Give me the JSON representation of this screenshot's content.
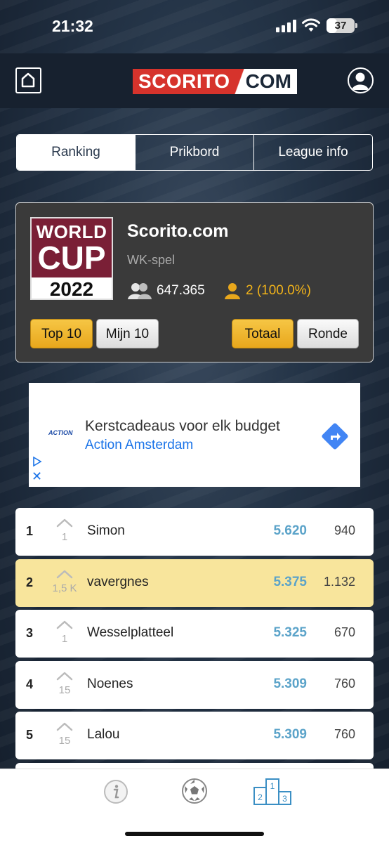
{
  "status_bar": {
    "time": "21:32",
    "battery": "37",
    "battery_level": 0.37
  },
  "header": {
    "logo_left": "SCORITO",
    "logo_right": "COM",
    "home_icon": "home-icon",
    "profile_icon": "user-icon"
  },
  "tabs": [
    {
      "label": "Ranking",
      "active": true
    },
    {
      "label": "Prikbord",
      "active": false
    },
    {
      "label": "League info",
      "active": false
    }
  ],
  "league": {
    "logo": {
      "line1": "WORLD",
      "line2": "CUP",
      "year": "2022"
    },
    "name": "Scorito.com",
    "subtitle": "WK-spel",
    "members": "647.365",
    "my_rank": "2 (100.0%)",
    "buttons": {
      "top10": "Top 10",
      "mijn10": "Mijn 10",
      "totaal": "Totaal",
      "ronde": "Ronde"
    },
    "colors": {
      "gold": "#f0b21a",
      "card": "#3a3a3a",
      "logo_bg": "#7a1f36"
    }
  },
  "ad": {
    "brand_logo": "ACTION",
    "title": "Kerstcadeaus voor elk budget",
    "subtitle": "Action Amsterdam",
    "close": "✕",
    "icons": [
      "directions-arrow-icon",
      "adchoices-icon",
      "close-icon"
    ]
  },
  "ranking": [
    {
      "position": "1",
      "movement": "1",
      "name": "Simon",
      "points": "5.620",
      "round": "940",
      "highlight": false
    },
    {
      "position": "2",
      "movement": "1,5 K",
      "name": "vavergnes",
      "points": "5.375",
      "round": "1.132",
      "highlight": true
    },
    {
      "position": "3",
      "movement": "1",
      "name": "Wesselplatteel",
      "points": "5.325",
      "round": "670",
      "highlight": false
    },
    {
      "position": "4",
      "movement": "15",
      "name": "Noenes",
      "points": "5.309",
      "round": "760",
      "highlight": false
    },
    {
      "position": "5",
      "movement": "15",
      "name": "Lalou",
      "points": "5.309",
      "round": "760",
      "highlight": false
    }
  ],
  "bottom_nav": {
    "items": [
      "info-icon",
      "football-icon",
      "podium-icon"
    ],
    "podium_labels": [
      "1",
      "2",
      "3"
    ],
    "accent": "#3b8fc4"
  }
}
